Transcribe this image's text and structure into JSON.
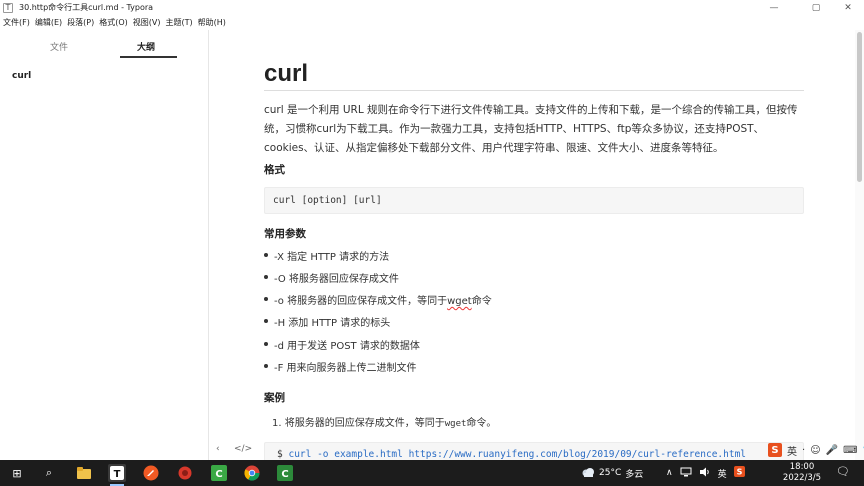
{
  "window": {
    "title": "30.http命令行工具curl.md - Typora",
    "controls": {
      "minimize": "—",
      "maximize": "▢",
      "close": "✕"
    }
  },
  "menu": [
    "文件(F)",
    "编辑(E)",
    "段落(P)",
    "格式(O)",
    "视图(V)",
    "主题(T)",
    "帮助(H)"
  ],
  "sidebar": {
    "tabs": {
      "files": "文件",
      "outline": "大纲"
    },
    "active_tab": "outline",
    "outline_items": [
      "curl"
    ],
    "footer": {
      "back": "‹",
      "source_toggle": "</>"
    }
  },
  "document": {
    "h1": "curl",
    "intro": "curl 是一个利用 URL 规则在命令行下进行文件传输工具。支持文件的上传和下载，是一个综合的传输工具，但按传统，习惯称curl为下载工具。作为一款强力工具，支持包括HTTP、HTTPS、ftp等众多协议，还支持POST、cookies、认证、从指定偏移处下载部分文件、用户代理字符串、限速、文件大小、进度条等特征。",
    "format_heading": "格式",
    "format_code": "curl [option] [url]",
    "params_heading": "常用参数",
    "params": [
      "-X 指定 HTTP 请求的方法",
      "-O 将服务器回应保存成文件",
      "-o 将服务器的回应保存成文件，等同于",
      "-H 添加 HTTP 请求的标头",
      "-d 用于发送 POST 请求的数据体",
      "-F 用来向服务器上传二进制文件"
    ],
    "param3_word": "wget",
    "param3_suffix": "命令",
    "cases_heading": "案例",
    "case1_num": "1.",
    "case1_prefix": "将服务器的回应保存成文件，等同于",
    "case1_code": "wget",
    "case1_suffix": "命令。",
    "case1_cmd_prompt": "$",
    "case1_cmd": "curl -o example.html https://www.ruanyifeng.com/blog/2019/09/curl-reference.html"
  },
  "ime": {
    "logo": "S",
    "mode": "英",
    "icons": [
      "·",
      "☺",
      "🎤",
      "⌨",
      "👕",
      "⋯"
    ]
  },
  "taskbar": {
    "start": "⊞",
    "search": "⌕",
    "weather_temp": "25°C",
    "weather_text": "多云",
    "tray_chevron": "∧",
    "tray_lang": "英",
    "time": "18:00",
    "date": "2022/3/5",
    "notification": "🗨"
  }
}
